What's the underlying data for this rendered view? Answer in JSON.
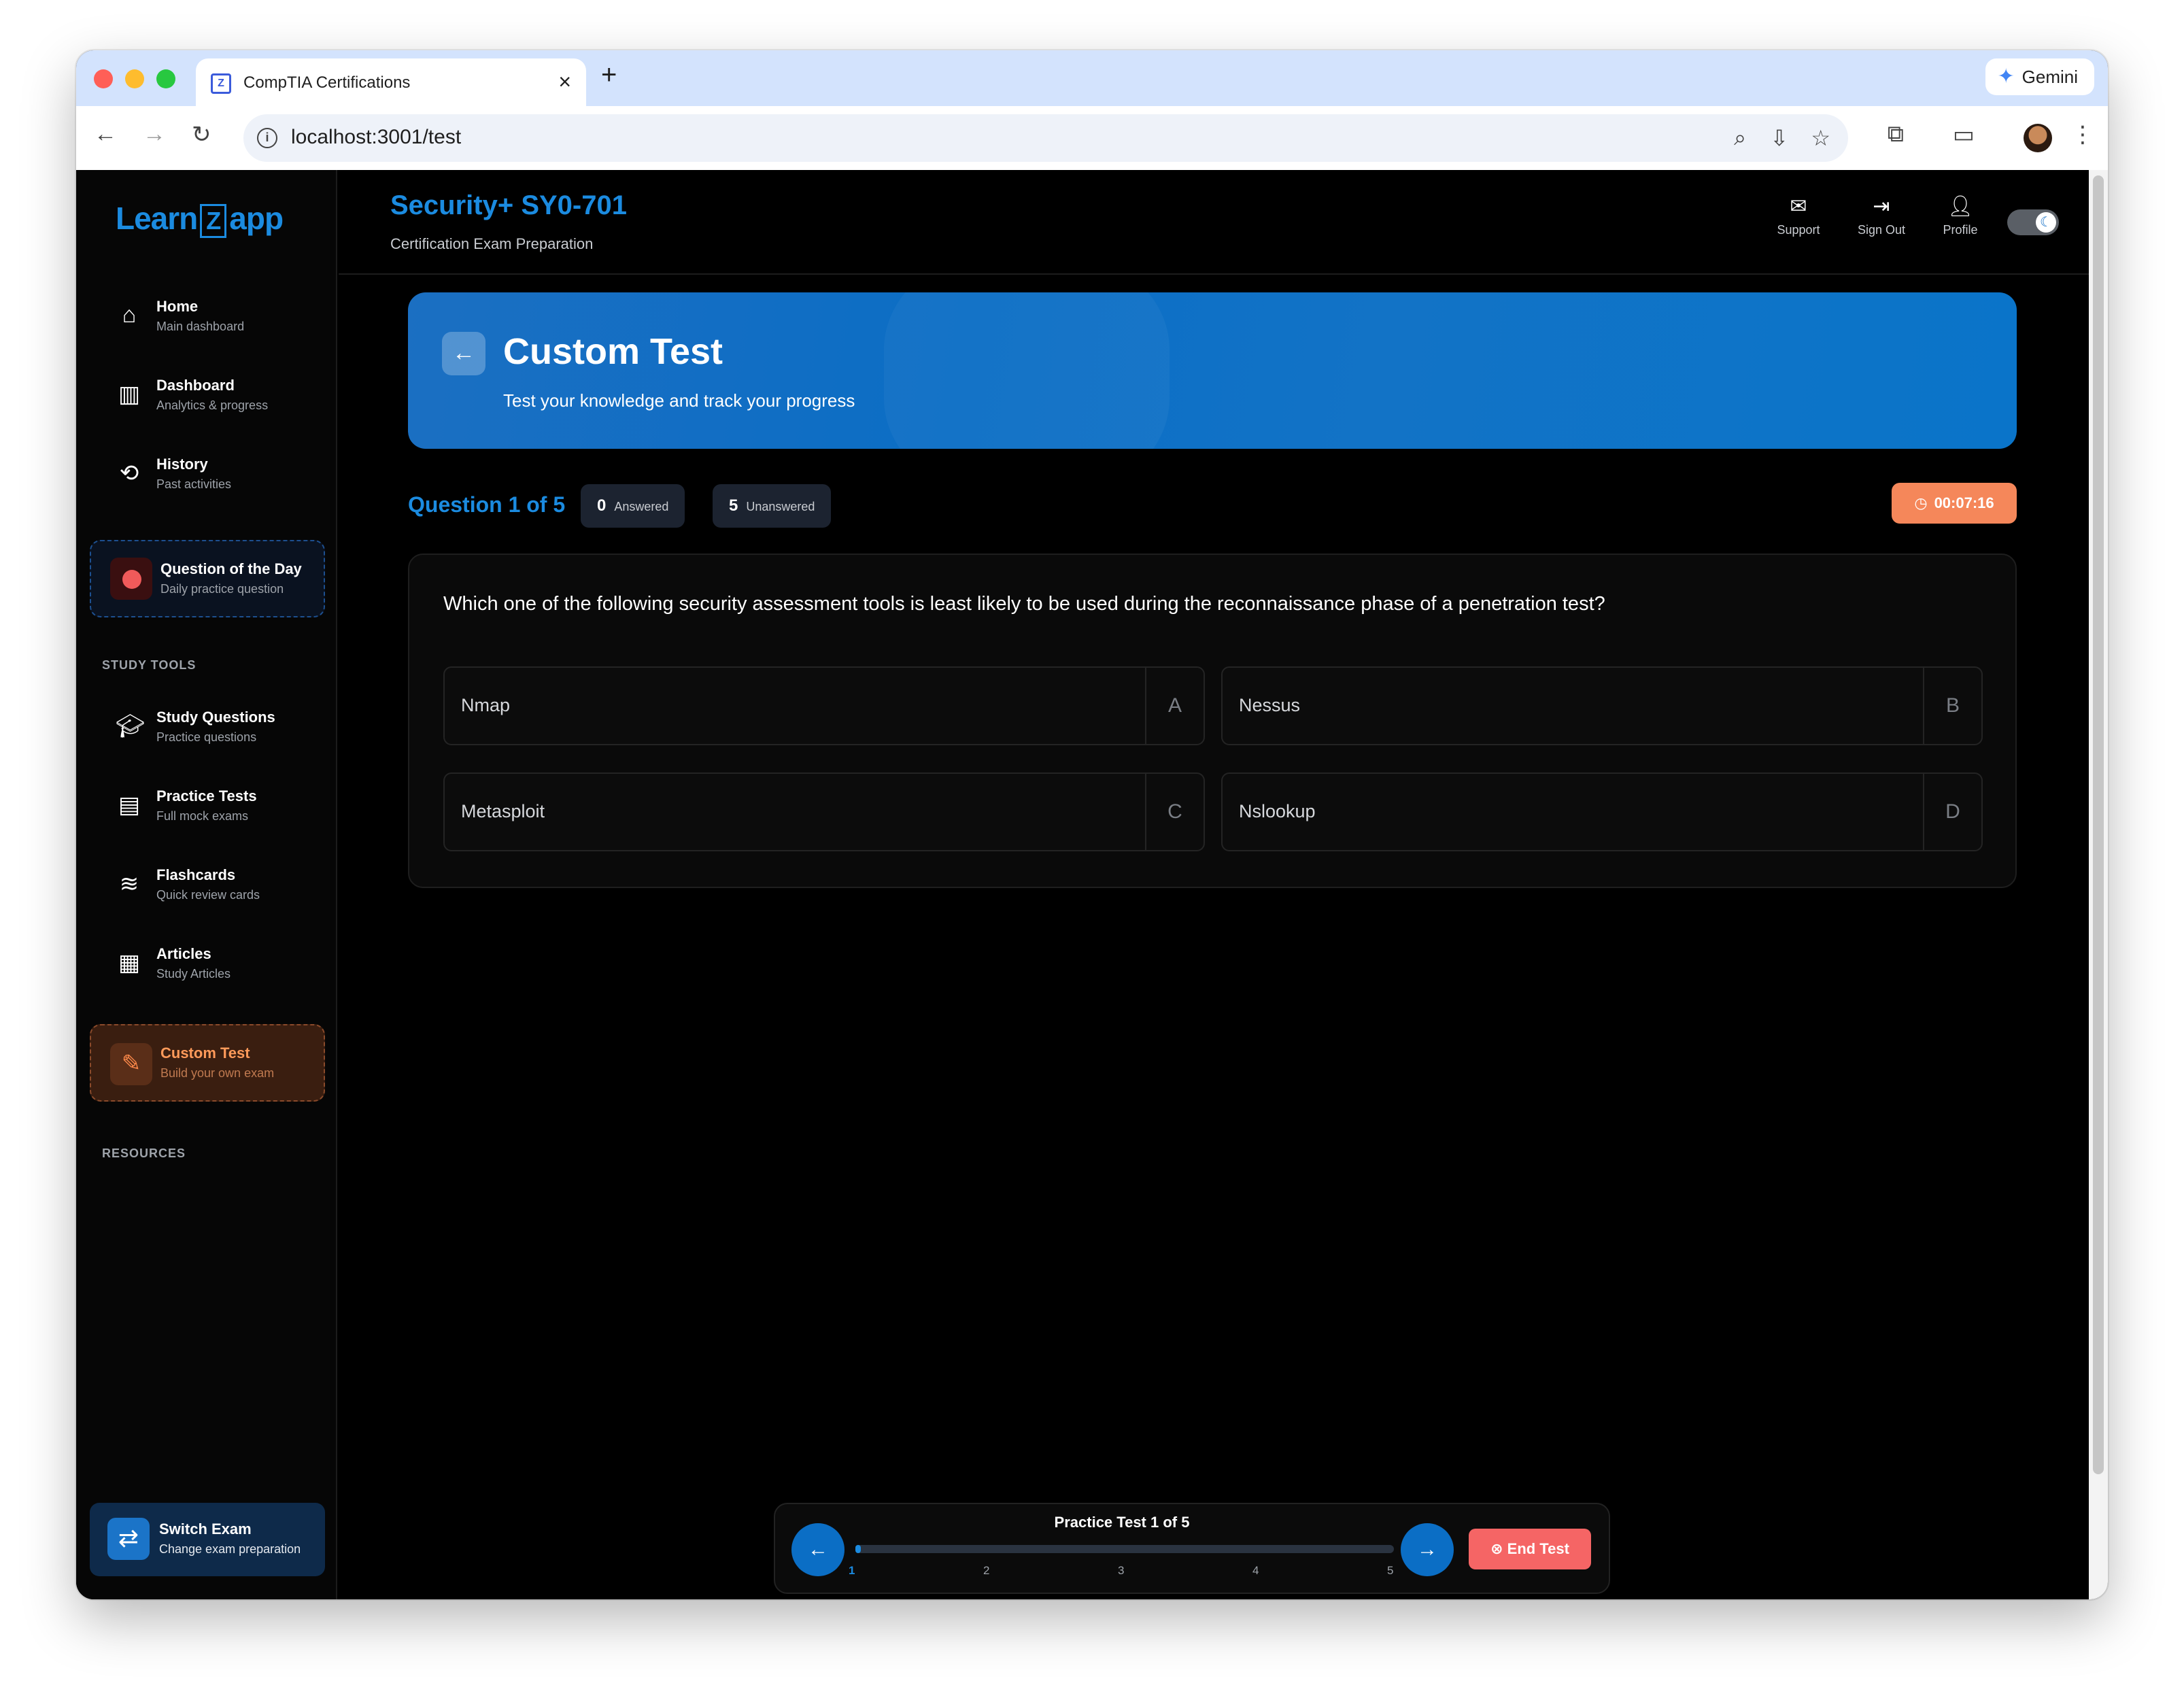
{
  "browser": {
    "tab_title": "CompTIA Certifications",
    "tab_favicon": "Z",
    "gemini_label": "Gemini",
    "url": "localhost:3001/test"
  },
  "sidebar": {
    "logo": {
      "pre": "Learn",
      "mid": "Z",
      "post": "app"
    },
    "items": [
      {
        "label": "Home",
        "sub": "Main dashboard",
        "icon": "home-icon"
      },
      {
        "label": "Dashboard",
        "sub": "Analytics & progress",
        "icon": "chart-icon"
      },
      {
        "label": "History",
        "sub": "Past activities",
        "icon": "history-icon"
      }
    ],
    "question_of_day": {
      "label": "Question of the Day",
      "sub": "Daily practice question"
    },
    "study_tools_heading": "STUDY TOOLS",
    "study_tools": [
      {
        "label": "Study Questions",
        "sub": "Practice questions",
        "icon": "graduation-cap-icon"
      },
      {
        "label": "Practice Tests",
        "sub": "Full mock exams",
        "icon": "clipboard-icon"
      },
      {
        "label": "Flashcards",
        "sub": "Quick review cards",
        "icon": "layers-icon"
      },
      {
        "label": "Articles",
        "sub": "Study Articles",
        "icon": "newspaper-icon"
      }
    ],
    "custom_test": {
      "label": "Custom Test",
      "sub": "Build your own exam"
    },
    "resources_heading": "RESOURCES",
    "switch_exam": {
      "label": "Switch Exam",
      "sub": "Change exam preparation"
    }
  },
  "header": {
    "title": "Security+ SY0-701",
    "subtitle": "Certification Exam Preparation",
    "support_label": "Support",
    "signout_label": "Sign Out",
    "profile_label": "Profile"
  },
  "banner": {
    "title": "Custom Test",
    "subtitle": "Test your knowledge and track your progress"
  },
  "question_meta": {
    "counter": "Question 1 of 5",
    "answered_count": "0",
    "answered_label": "Answered",
    "unanswered_count": "5",
    "unanswered_label": "Unanswered",
    "timer": "00:07:16"
  },
  "question": {
    "text": "Which one of the following security assessment tools is least likely to be used during the reconnaissance phase of a penetration test?",
    "options": [
      {
        "text": "Nmap",
        "key": "A"
      },
      {
        "text": "Nessus",
        "key": "B"
      },
      {
        "text": "Metasploit",
        "key": "C"
      },
      {
        "text": "Nslookup",
        "key": "D"
      }
    ]
  },
  "bottom_nav": {
    "label": "Practice Test 1 of 5",
    "progress": 0.01,
    "ticks": [
      "1",
      "2",
      "3",
      "4",
      "5"
    ],
    "end_test_label": "End Test"
  },
  "colors": {
    "accent": "#1b8be0",
    "timer": "#f5875a",
    "end_test": "#f56565",
    "custom_test": "#ff9a5a"
  }
}
